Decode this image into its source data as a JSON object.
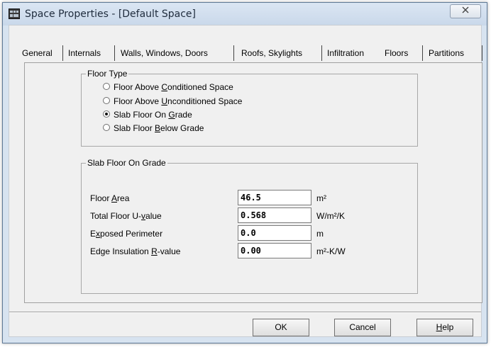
{
  "window": {
    "title": "Space Properties - [Default Space]",
    "close_label": "⌦"
  },
  "tabs": [
    {
      "label": "General"
    },
    {
      "label": "Internals"
    },
    {
      "label": "Walls, Windows, Doors"
    },
    {
      "label": "Roofs, Skylights"
    },
    {
      "label": "Infiltration"
    },
    {
      "label": "Floors",
      "selected": true
    },
    {
      "label": "Partitions"
    }
  ],
  "floor_type": {
    "title": "Floor Type",
    "options": [
      {
        "pre": "Floor Above ",
        "accel": "C",
        "post": "onditioned Space",
        "checked": false
      },
      {
        "pre": "Floor Above ",
        "accel": "U",
        "post": "nconditioned Space",
        "checked": false
      },
      {
        "pre": "Slab Floor On ",
        "accel": "G",
        "post": "rade",
        "checked": true
      },
      {
        "pre": "Slab Floor ",
        "accel": "B",
        "post": "elow Grade",
        "checked": false
      }
    ]
  },
  "slab": {
    "title": "Slab Floor On Grade",
    "fields": [
      {
        "pre": "Floor ",
        "accel": "A",
        "post": "rea",
        "value": "46.5",
        "unit": "m²"
      },
      {
        "pre": "Total Floor U-",
        "accel": "v",
        "post": "alue",
        "value": "0.568",
        "unit": "W/m²/K"
      },
      {
        "pre": "E",
        "accel": "x",
        "post": "posed Perimeter",
        "value": "0.0",
        "unit": "m"
      },
      {
        "pre": "Edge Insulation ",
        "accel": "R",
        "post": "-value",
        "value": "0.00",
        "unit": "m²-K/W"
      }
    ]
  },
  "buttons": {
    "ok": "OK",
    "cancel": "Cancel",
    "help_accel": "H",
    "help_rest": "elp"
  },
  "colors": {
    "titlebar": "#d7e3f0",
    "dialog_bg": "#f0f0f0"
  }
}
